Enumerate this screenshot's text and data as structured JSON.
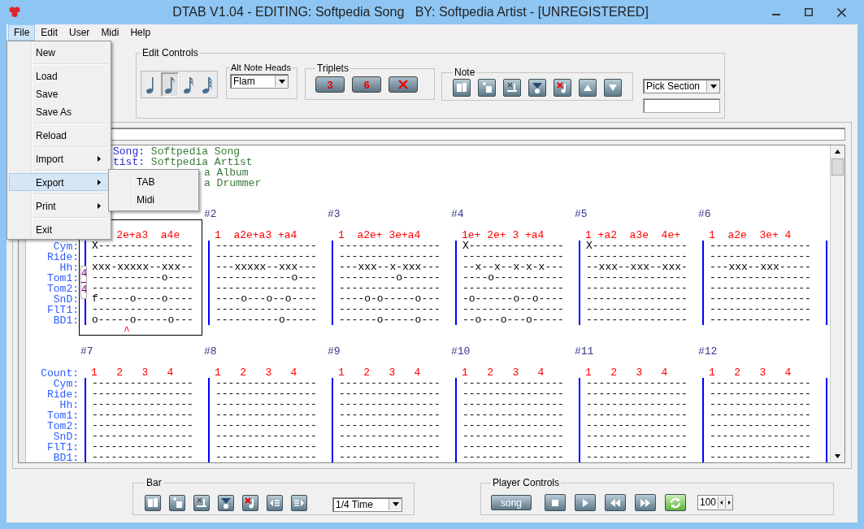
{
  "window": {
    "title": "DTAB V1.04 - EDITING: Softpedia Song   BY: Softpedia Artist - [UNREGISTERED]"
  },
  "menubar": [
    {
      "label": "File",
      "selected": true
    },
    {
      "label": "Edit",
      "selected": false
    },
    {
      "label": "User",
      "selected": false
    },
    {
      "label": "Midi",
      "selected": false
    },
    {
      "label": "Help",
      "selected": false
    }
  ],
  "file_menu": {
    "items": [
      {
        "kind": "item",
        "label": "New",
        "submenu": false,
        "selected": false
      },
      {
        "kind": "separator"
      },
      {
        "kind": "item",
        "label": "Load",
        "submenu": false,
        "selected": false
      },
      {
        "kind": "item",
        "label": "Save",
        "submenu": false,
        "selected": false
      },
      {
        "kind": "item",
        "label": "Save As",
        "submenu": false,
        "selected": false
      },
      {
        "kind": "separator"
      },
      {
        "kind": "item",
        "label": "Reload",
        "submenu": false,
        "selected": false
      },
      {
        "kind": "separator"
      },
      {
        "kind": "item",
        "label": "Import",
        "submenu": true,
        "selected": false
      },
      {
        "kind": "separator"
      },
      {
        "kind": "item",
        "label": "Export",
        "submenu": true,
        "selected": true
      },
      {
        "kind": "separator"
      },
      {
        "kind": "item",
        "label": "Print",
        "submenu": true,
        "selected": false
      },
      {
        "kind": "separator"
      },
      {
        "kind": "item",
        "label": "Exit",
        "submenu": false,
        "selected": false
      }
    ]
  },
  "export_submenu": {
    "items": [
      {
        "label": "TAB",
        "selected": false
      },
      {
        "label": "Midi",
        "selected": false
      }
    ]
  },
  "edit_controls": {
    "title": "Edit Controls",
    "note_buttons": [
      {
        "kind": "quarter",
        "selected": false
      },
      {
        "kind": "eighth",
        "selected": true
      },
      {
        "kind": "sixteenth",
        "selected": false
      },
      {
        "kind": "thirty_second",
        "selected": false
      }
    ],
    "alt_note_heads": {
      "title": "Alt Note Heads",
      "value": "Flam"
    },
    "triplets": {
      "title": "Triplets",
      "buttons": [
        {
          "kind": "text",
          "label": "3"
        },
        {
          "kind": "text",
          "label": "6"
        },
        {
          "kind": "clear"
        }
      ]
    },
    "note": {
      "title": "Note",
      "buttons": [
        {
          "kind": "copy"
        },
        {
          "kind": "insert"
        },
        {
          "kind": "clear"
        },
        {
          "kind": "fill"
        },
        {
          "kind": "delete"
        },
        {
          "kind": "up"
        },
        {
          "kind": "down"
        }
      ]
    },
    "pick_section": {
      "value": "Pick Section"
    }
  },
  "tab": {
    "header_lines": [
      {
        "label": "Song:",
        "value": "Softpedia Song"
      },
      {
        "label": "tist:",
        "value": "Softpedia Artist"
      },
      {
        "value": "a Album"
      },
      {
        "value": "a Drummer"
      }
    ],
    "rows": [
      {
        "track_labels": [
          "Cym:",
          "Ride:",
          "Hh:",
          "Tom1:",
          "Tom2:",
          "SnD:",
          "FlT1:",
          "BD1:"
        ],
        "bars": [
          {
            "count": "    2e+a3  a4e",
            "selected": true,
            "time_signature": [
              "4",
              "4"
            ],
            "caret": "     ^",
            "lines": [
              "X---------------",
              "----------------",
              "xxx-xxxxx--xxx--",
              "-----------o----",
              "----------------",
              "f-----o----o----",
              "----------------",
              "o-----o-----o---"
            ]
          },
          {
            "number": "#2",
            "count": "1  a2e+a3 +a4",
            "selected": false,
            "lines": [
              "----------------",
              "----------------",
              "---xxxxx--xxx---",
              "------------o---",
              "----------------",
              "----o---o--o----",
              "----------------",
              "----------o-----"
            ]
          },
          {
            "number": "#3",
            "count": "1  a2e+ 3e+a4",
            "selected": false,
            "lines": [
              "----------------",
              "----------------",
              "---xxx--x-xxx---",
              "---------o------",
              "----------------",
              "----o-o-----o---",
              "----------------",
              "------o-----o---"
            ]
          },
          {
            "number": "#4",
            "count": "1e+ 2e+ 3 +a4",
            "selected": false,
            "lines": [
              "X---------------",
              "----------------",
              "--x--x--x-x-x---",
              "----o-----------",
              "----------------",
              "-o------o--o----",
              "----------------",
              "--o---o---o-----"
            ]
          },
          {
            "number": "#5",
            "count": "1 +a2  a3e  4e+",
            "selected": false,
            "lines": [
              "X---------------",
              "----------------",
              "--xxx--xxx--xxx-",
              "----------------",
              "----------------",
              "----------------",
              "----------------",
              "----------------"
            ]
          },
          {
            "number": "#6",
            "count": "1  a2e  3e+ 4",
            "selected": false,
            "lines": [
              "----------------",
              "----------------",
              "---xxx--xxx-----",
              "----------------",
              "----------------",
              "----------------",
              "----------------",
              "----------------"
            ]
          }
        ]
      },
      {
        "count_label": "Count:",
        "track_labels": [
          "Cym:",
          "Ride:",
          "Hh:",
          "Tom1:",
          "Tom2:",
          "SnD:",
          "FlT1:",
          "BD1:"
        ],
        "bars": [
          {
            "number": "#7",
            "count": "1   2   3   4",
            "selected": false,
            "lines": [
              "----------------",
              "----------------",
              "----------------",
              "----------------",
              "----------------",
              "----------------",
              "----------------",
              "----------------"
            ]
          },
          {
            "number": "#8",
            "count": "1   2   3   4",
            "selected": false,
            "lines": [
              "----------------",
              "----------------",
              "----------------",
              "----------------",
              "----------------",
              "----------------",
              "----------------",
              "----------------"
            ]
          },
          {
            "number": "#9",
            "count": "1   2   3   4",
            "selected": false,
            "lines": [
              "----------------",
              "----------------",
              "----------------",
              "----------------",
              "----------------",
              "----------------",
              "----------------",
              "----------------"
            ]
          },
          {
            "number": "#10",
            "count": "1   2   3   4",
            "selected": false,
            "lines": [
              "----------------",
              "----------------",
              "----------------",
              "----------------",
              "----------------",
              "----------------",
              "----------------",
              "----------------"
            ]
          },
          {
            "number": "#11",
            "count": "1   2   3   4",
            "selected": false,
            "lines": [
              "----------------",
              "----------------",
              "----------------",
              "----------------",
              "----------------",
              "----------------",
              "----------------",
              "----------------"
            ]
          },
          {
            "number": "#12",
            "count": "1   2   3   4",
            "selected": false,
            "lines": [
              "----------------",
              "----------------",
              "----------------",
              "----------------",
              "----------------",
              "----------------",
              "----------------",
              "----------------"
            ]
          }
        ]
      }
    ]
  },
  "bar_controls": {
    "title": "Bar",
    "buttons": [
      {
        "kind": "copy"
      },
      {
        "kind": "insert"
      },
      {
        "kind": "clear"
      },
      {
        "kind": "fill"
      },
      {
        "kind": "delete"
      },
      {
        "kind": "left"
      },
      {
        "kind": "right"
      }
    ],
    "time_select": "1/4 Time"
  },
  "player_controls": {
    "title": "Player Controls",
    "song_button": "song",
    "buttons": [
      {
        "kind": "stop"
      },
      {
        "kind": "play"
      },
      {
        "kind": "rewind"
      },
      {
        "kind": "forward"
      },
      {
        "kind": "loop"
      }
    ],
    "tempo": "100"
  }
}
